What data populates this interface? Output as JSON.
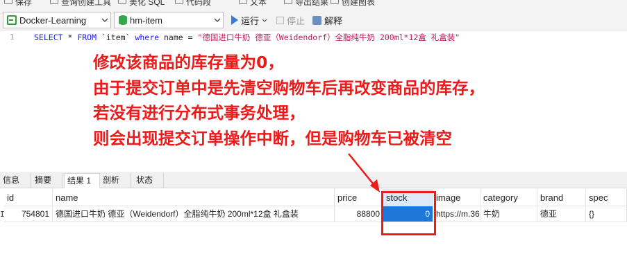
{
  "top_toolbar": {
    "items": [
      "保存",
      "查询创建工具",
      "美化 SQL",
      "代码段",
      "文本",
      "导出结果",
      "创建图表"
    ]
  },
  "connection": {
    "connection_name": "Docker-Learning",
    "database_name": "hm-item",
    "run_label": "运行",
    "stop_label": "停止",
    "explain_label": "解释"
  },
  "editor": {
    "line_number": "1",
    "sql_keyword_select": "SELECT",
    "sql_star": " * ",
    "sql_keyword_from": "FROM",
    "sql_table": " `item` ",
    "sql_keyword_where": "where",
    "sql_column": " name = ",
    "sql_string": "\"德国进口牛奶 德亚（Weidendorf）全脂纯牛奶 200ml*12盒 礼盒装\""
  },
  "annotation": {
    "line1": "修改该商品的库存量为0，",
    "line2": "由于提交订单中是先清空购物车后再改变商品的库存，",
    "line3": "若没有进行分布式事务处理，",
    "line4": "则会出现提交订单操作中断，但是购物车已被清空"
  },
  "result_tabs": [
    {
      "label": "信息",
      "active": false
    },
    {
      "label": "摘要",
      "active": false
    },
    {
      "label": "结果 1",
      "active": true
    },
    {
      "label": "剖析",
      "active": false
    },
    {
      "label": "状态",
      "active": false
    }
  ],
  "grid": {
    "columns": [
      "id",
      "name",
      "price",
      "stock",
      "image",
      "category",
      "brand",
      "spec"
    ],
    "row": {
      "marker": "I",
      "id": "754801",
      "name": "德国进口牛奶 德亚（Weidendorf）全脂纯牛奶 200ml*12盒 礼盒装",
      "price": "88800",
      "stock": "0",
      "image": "https://m.360",
      "category": "牛奶",
      "brand": "德亚",
      "spec": "{}"
    }
  },
  "colors": {
    "annotation_red": "#ee1a1a",
    "selection_blue": "#1e78d7",
    "sql_keyword": "#1a1aff",
    "sql_string": "#c2185b"
  }
}
